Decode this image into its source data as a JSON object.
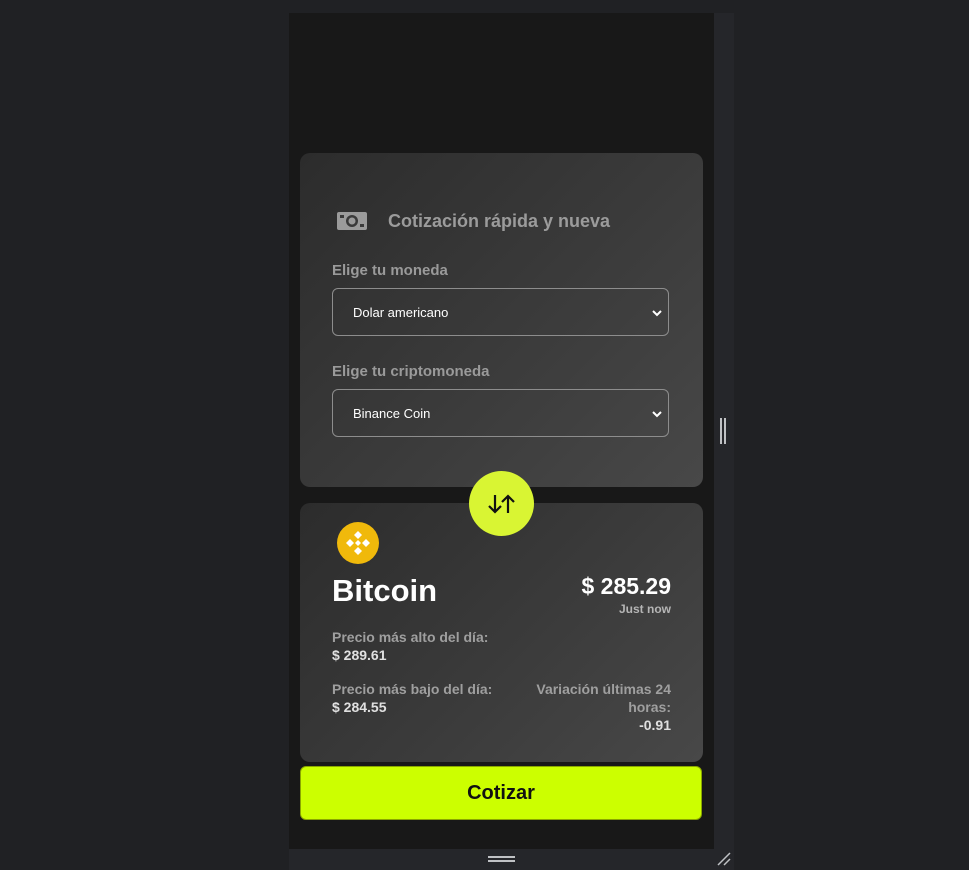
{
  "form": {
    "title": "Cotización rápida y nueva",
    "currency_label": "Elige tu moneda",
    "currency_selected": "Dolar americano",
    "crypto_label": "Elige tu criptomoneda",
    "crypto_selected": "Binance Coin"
  },
  "result": {
    "coin_name": "Bitcoin",
    "price": "$ 285.29",
    "updated": "Just now",
    "high_label": "Precio más alto del día:",
    "high_value": "$ 289.61",
    "low_label": "Precio más bajo del día:",
    "low_value": "$ 284.55",
    "variation_label_1": "Variación últimas 24",
    "variation_label_2": "horas:",
    "variation_value": "-0.91"
  },
  "button": {
    "cotizar_label": "Cotizar"
  },
  "icons": {
    "money": "money-bill-icon",
    "swap": "swap-arrows-icon",
    "coin": "binance-coin-logo",
    "chevron": "chevron-down-icon"
  },
  "colors": {
    "accent": "#ccff00",
    "swap_button": "#d9f533",
    "coin_logo": "#f0b90b",
    "background": "#181818"
  }
}
